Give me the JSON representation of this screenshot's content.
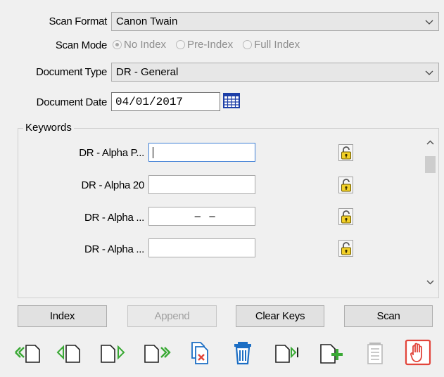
{
  "scan_format": {
    "label": "Scan Format",
    "value": "Canon Twain"
  },
  "scan_mode": {
    "label": "Scan Mode",
    "options": [
      {
        "label": "No Index",
        "selected": true
      },
      {
        "label": "Pre-Index",
        "selected": false
      },
      {
        "label": "Full Index",
        "selected": false
      }
    ]
  },
  "document_type": {
    "label": "Document Type",
    "value": "DR - General"
  },
  "document_date": {
    "label": "Document Date",
    "value": "04/01/2017"
  },
  "keywords": {
    "title": "Keywords",
    "rows": [
      {
        "label": "DR - Alpha P...",
        "value": ""
      },
      {
        "label": "DR - Alpha 20",
        "value": ""
      },
      {
        "label": "DR - Alpha ...",
        "value": "  –   –"
      },
      {
        "label": "DR - Alpha ...",
        "value": ""
      }
    ]
  },
  "buttons": {
    "index": "Index",
    "append": "Append",
    "clear_keys": "Clear Keys",
    "scan": "Scan"
  },
  "toolbar_icons": [
    "first-page-icon",
    "previous-page-icon",
    "next-page-icon",
    "last-page-icon",
    "delete-page-icon",
    "delete-document-icon",
    "insert-page-icon",
    "add-page-icon",
    "document-properties-icon",
    "stop-icon"
  ],
  "colors": {
    "icon_green": "#3aa935",
    "icon_blue": "#1c6ec4",
    "icon_red": "#e2443a",
    "focus_border": "#3f7fd6"
  }
}
